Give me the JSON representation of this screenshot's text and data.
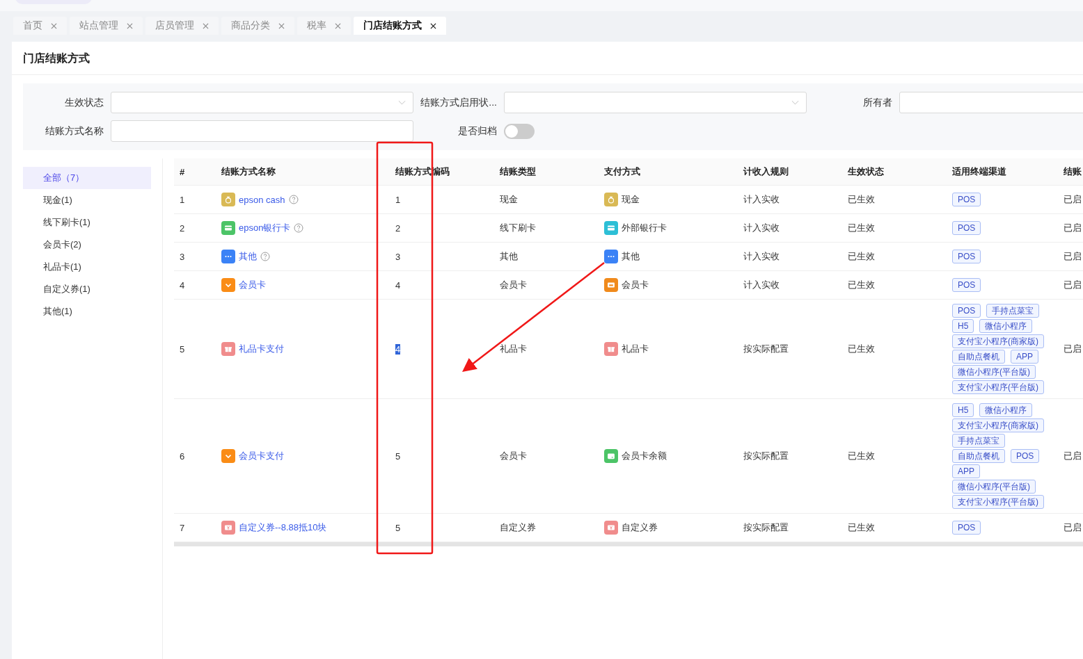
{
  "tabs": [
    {
      "label": "首页",
      "selected": false
    },
    {
      "label": "站点管理",
      "selected": false
    },
    {
      "label": "店员管理",
      "selected": false
    },
    {
      "label": "商品分类",
      "selected": false
    },
    {
      "label": "税率",
      "selected": false
    },
    {
      "label": "门店结账方式",
      "selected": true
    }
  ],
  "page_title": "门店结账方式",
  "filters": {
    "status": {
      "label": "生效状态"
    },
    "enable_status": {
      "label": "结账方式启用状..."
    },
    "owner": {
      "label": "所有者"
    },
    "name": {
      "label": "结账方式名称"
    },
    "archived": {
      "label": "是否归档",
      "on": false
    }
  },
  "sidebar": {
    "items": [
      {
        "label": "全部（7）",
        "selected": true
      },
      {
        "label": "现金(1)",
        "selected": false
      },
      {
        "label": "线下刷卡(1)",
        "selected": false
      },
      {
        "label": "会员卡(2)",
        "selected": false
      },
      {
        "label": "礼品卡(1)",
        "selected": false
      },
      {
        "label": "自定义券(1)",
        "selected": false
      },
      {
        "label": "其他(1)",
        "selected": false
      }
    ]
  },
  "table": {
    "columns": [
      "#",
      "结账方式名称",
      "结账方式编码",
      "结账类型",
      "支付方式",
      "计收入规则",
      "生效状态",
      "适用终端渠道",
      "结账"
    ],
    "rows": [
      {
        "index": "1",
        "name": "epson cash",
        "name_icon": {
          "kind": "cash"
        },
        "has_help": true,
        "code": "1",
        "code_highlighted": false,
        "type": "现金",
        "pay_icon": {
          "kind": "cash"
        },
        "payment": "现金",
        "rule": "计入实收",
        "status": "已生效",
        "channels": [
          "POS"
        ],
        "column_9": "已启"
      },
      {
        "index": "2",
        "name": "epson银行卡",
        "name_icon": {
          "kind": "card"
        },
        "has_help": true,
        "code": "2",
        "code_highlighted": false,
        "type": "线下刷卡",
        "pay_icon": {
          "kind": "bankcard"
        },
        "payment": "外部银行卡",
        "rule": "计入实收",
        "status": "已生效",
        "channels": [
          "POS"
        ],
        "column_9": "已启"
      },
      {
        "index": "3",
        "name": "其他",
        "name_icon": {
          "kind": "more"
        },
        "has_help": true,
        "code": "3",
        "code_highlighted": false,
        "type": "其他",
        "pay_icon": {
          "kind": "more"
        },
        "payment": "其他",
        "rule": "计入实收",
        "status": "已生效",
        "channels": [
          "POS"
        ],
        "column_9": "已启"
      },
      {
        "index": "4",
        "name": "会员卡",
        "name_icon": {
          "kind": "member"
        },
        "has_help": false,
        "code": "4",
        "code_highlighted": false,
        "type": "会员卡",
        "pay_icon": {
          "kind": "vip"
        },
        "payment": "会员卡",
        "rule": "计入实收",
        "status": "已生效",
        "channels": [
          "POS"
        ],
        "column_9": "已启"
      },
      {
        "index": "5",
        "name": "礼品卡支付",
        "name_icon": {
          "kind": "gift"
        },
        "has_help": false,
        "code": "4",
        "code_highlighted": true,
        "type": "礼品卡",
        "pay_icon": {
          "kind": "gift"
        },
        "payment": "礼品卡",
        "rule": "按实际配置",
        "status": "已生效",
        "channels": [
          "POS",
          "手持点菜宝",
          "H5",
          "微信小程序",
          "支付宝小程序(商家版)",
          "自助点餐机",
          "APP",
          "微信小程序(平台版)",
          "支付宝小程序(平台版)"
        ],
        "column_9": "已启"
      },
      {
        "index": "6",
        "name": "会员卡支付",
        "name_icon": {
          "kind": "member"
        },
        "has_help": false,
        "code": "5",
        "code_highlighted": false,
        "type": "会员卡",
        "pay_icon": {
          "kind": "wallet"
        },
        "payment": "会员卡余额",
        "rule": "按实际配置",
        "status": "已生效",
        "channels": [
          "H5",
          "微信小程序",
          "支付宝小程序(商家版)",
          "手持点菜宝",
          "自助点餐机",
          "POS",
          "APP",
          "微信小程序(平台版)",
          "支付宝小程序(平台版)"
        ],
        "column_9": "已启"
      },
      {
        "index": "7",
        "name": "自定义券--8.88抵10块",
        "name_icon": {
          "kind": "coupon"
        },
        "has_help": false,
        "code": "5",
        "code_highlighted": false,
        "type": "自定义券",
        "pay_icon": {
          "kind": "coupon"
        },
        "payment": "自定义券",
        "rule": "按实际配置",
        "status": "已生效",
        "channels": [
          "POS"
        ],
        "column_9": "已启"
      }
    ]
  }
}
